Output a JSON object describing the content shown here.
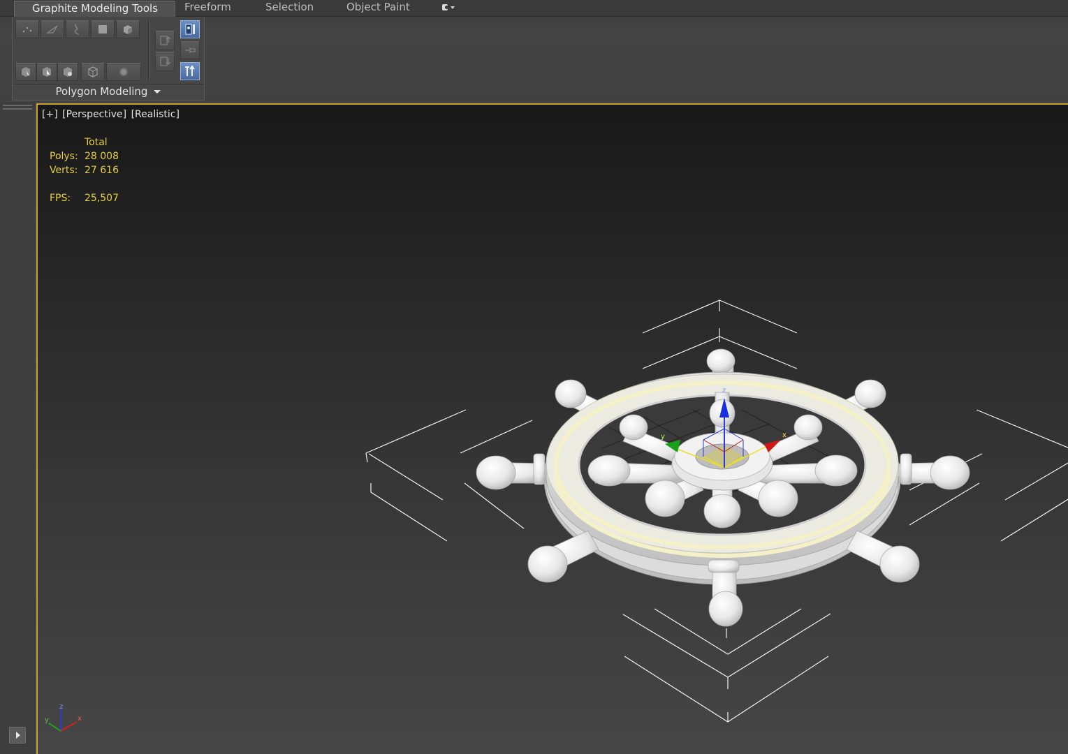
{
  "ribbon": {
    "tabs": [
      {
        "label": "Graphite Modeling Tools",
        "active": true
      },
      {
        "label": "Freeform",
        "active": false
      },
      {
        "label": "Selection",
        "active": false
      },
      {
        "label": "Object Paint",
        "active": false
      }
    ],
    "extra_dropdown_icon": "camera-icon",
    "panel": {
      "label": "Polygon Modeling",
      "row1_icons": [
        "vertex-icon",
        "edge-icon",
        "border-icon",
        "polygon-icon",
        "element-icon"
      ],
      "row2_icons": [
        "modify-mode-icon",
        "cursor-mode-icon",
        "preview-icon",
        "ignore-backfacing-icon",
        "soft-select-icon"
      ],
      "stack_icons": [
        "previous-modifier-icon",
        "next-modifier-icon"
      ],
      "right_icons": [
        "show-end-result-icon",
        "pin-stack-icon",
        "collapse-stack-icon"
      ]
    }
  },
  "viewport": {
    "label_parts": [
      "[+]",
      "[Perspective]",
      "[Realistic]"
    ],
    "stats": {
      "header": "Total",
      "polys_label": "Polys:",
      "polys_value": "28 008",
      "verts_label": "Verts:",
      "verts_value": "27 616",
      "fps_label": "FPS:",
      "fps_value": "25,507"
    },
    "gizmo_axes": {
      "x": "x",
      "y": "y",
      "z": "z"
    },
    "corner_axes": {
      "x": "x",
      "y": "y",
      "z": "z"
    },
    "colors": {
      "border_active": "#c9a223",
      "stats_text": "#e6cf3c",
      "axis_x": "#d02020",
      "axis_y": "#20a020",
      "axis_z": "#2040e0"
    }
  }
}
